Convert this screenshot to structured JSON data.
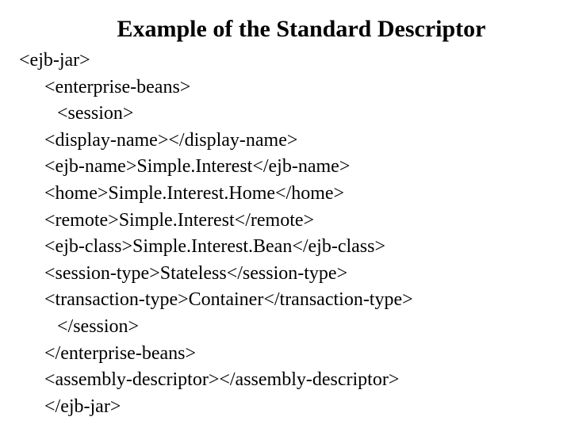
{
  "title": "Example of the Standard Descriptor",
  "lines": [
    {
      "indent": "ind1",
      "text": "<ejb-jar>"
    },
    {
      "indent": "ind2",
      "text": "<enterprise-beans>"
    },
    {
      "indent": "ind3",
      "text": "<session>"
    },
    {
      "indent": "ind2",
      "text": "<display-name></display-name>"
    },
    {
      "indent": "ind2",
      "text": "<ejb-name>Simple.Interest</ejb-name>"
    },
    {
      "indent": "ind2",
      "text": "<home>Simple.Interest.Home</home>"
    },
    {
      "indent": "ind2",
      "text": "<remote>Simple.Interest</remote>"
    },
    {
      "indent": "ind2",
      "text": "<ejb-class>Simple.Interest.Bean</ejb-class>"
    },
    {
      "indent": "ind2",
      "text": "<session-type>Stateless</session-type>"
    },
    {
      "indent": "ind2",
      "text": "<transaction-type>Container</transaction-type>"
    },
    {
      "indent": "ind3",
      "text": "</session>"
    },
    {
      "indent": "ind2",
      "text": "</enterprise-beans>"
    },
    {
      "indent": "ind2",
      "text": "<assembly-descriptor></assembly-descriptor>"
    },
    {
      "indent": "ind2",
      "text": "</ejb-jar>"
    }
  ]
}
